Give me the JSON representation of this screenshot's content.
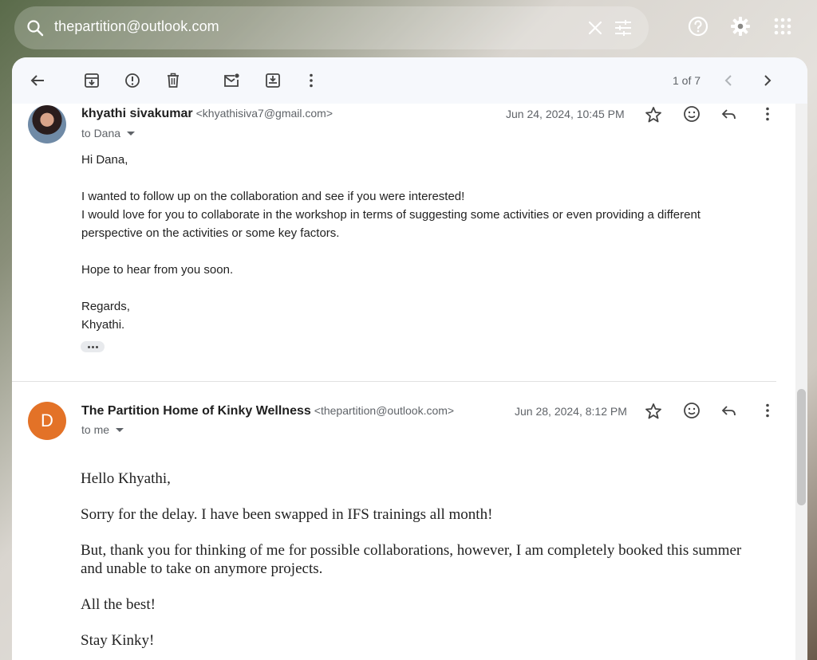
{
  "search": {
    "query": "thepartition@outlook.com"
  },
  "toolbar": {
    "count": "1 of 7"
  },
  "messages": [
    {
      "sender_name": "khyathi sivakumar",
      "sender_email": "<khyathisiva7@gmail.com>",
      "to": "to Dana",
      "date": "Jun 24, 2024, 10:45 PM",
      "body": [
        "Hi Dana,",
        "",
        "I wanted to follow up on the collaboration and see if you were interested!",
        "I would love for you to collaborate in the workshop in terms of suggesting some activities or even providing a different perspective on the activities or some key factors.",
        "",
        "Hope to hear from you soon.",
        "",
        "Regards,",
        "Khyathi."
      ]
    },
    {
      "avatar_letter": "D",
      "sender_name": "The Partition Home of Kinky Wellness",
      "sender_email": "<thepartition@outlook.com>",
      "to": "to me",
      "date": "Jun 28, 2024, 8:12 PM",
      "body": [
        "Hello Khyathi,",
        "Sorry for the delay. I have been swapped in IFS trainings all month!",
        "But, thank you for thinking of me for possible collaborations, however, I am completely booked this summer and unable to take on anymore projects.",
        "All the best!",
        "Stay Kinky!"
      ]
    }
  ],
  "colors": {
    "accent_avatar": "#e37227",
    "toolbar_bg": "#f6f8fc"
  }
}
